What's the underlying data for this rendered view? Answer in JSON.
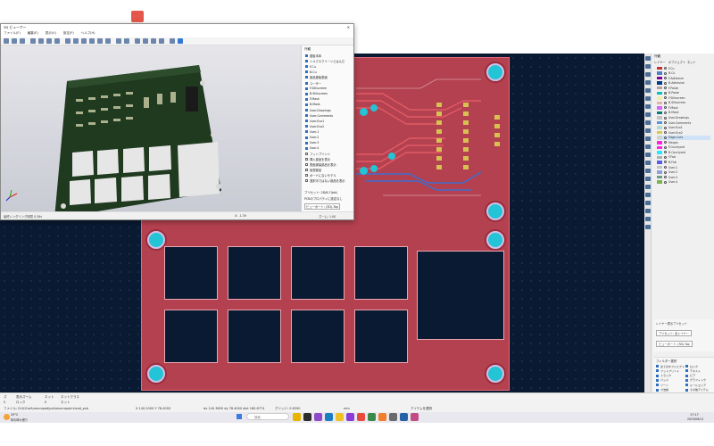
{
  "viewer": {
    "title": "3D ビューアー",
    "menu": [
      "ファイル(F)",
      "編集(E)",
      "表示(V)",
      "設定(P)",
      "ヘルプ(H)"
    ],
    "panel_title": "外観",
    "panel_items": [
      "基板本体",
      "シルクスクリーンとはんだ",
      "F.Cu",
      "B.Cu",
      "部品基板表面",
      "ユーザー",
      "F.Silkscreen",
      "B.Silkscreen",
      "F.Mask",
      "B.Mask",
      "User.Drawings",
      "User.Comments",
      "User.Eco1",
      "User.Eco2",
      "User.1",
      "User.2",
      "User.3",
      "User.4",
      "フットプリント",
      "挿入部品を表示",
      "表面実装部品を表示",
      "仮想部品",
      "ボードにないモデル",
      "選択中ではない部品を表示"
    ],
    "preset_label": "プリセット: 2D/6.7(blk)",
    "preset_value": "PCBのプロパティに設定なし",
    "viewport_label": "ビューポート: (3D)-Top",
    "status_left": "最終レンダリング時間 0.36s",
    "status_mid": "X: -1.39",
    "status_right": "ズーム: 1.00"
  },
  "layers": {
    "tabs": [
      "レイヤー",
      "オブジェクト",
      "ネット"
    ],
    "header": "外観",
    "items": [
      {
        "name": "F.Cu",
        "color": "#c83232"
      },
      {
        "name": "B.Cu",
        "color": "#4d7fc4"
      },
      {
        "name": "F.Adhesive",
        "color": "#84009a"
      },
      {
        "name": "B.Adhesive",
        "color": "#003a8c"
      },
      {
        "name": "F.Paste",
        "color": "#b4a0a0"
      },
      {
        "name": "B.Paste",
        "color": "#00c2c2"
      },
      {
        "name": "F.Silkscreen",
        "color": "#f2edaa"
      },
      {
        "name": "B.Silkscreen",
        "color": "#e8b2a7"
      },
      {
        "name": "F.Mask",
        "color": "#d864ff"
      },
      {
        "name": "B.Mask",
        "color": "#027b7b"
      },
      {
        "name": "User.Drawings",
        "color": "#c2c2c2"
      },
      {
        "name": "User.Comments",
        "color": "#5994dc"
      },
      {
        "name": "User.Eco1",
        "color": "#b4dbd2"
      },
      {
        "name": "User.Eco2",
        "color": "#d8c852"
      },
      {
        "name": "Edge.Cuts",
        "color": "#d0d2cd"
      },
      {
        "name": "Margin",
        "color": "#ff26e2"
      },
      {
        "name": "F.Courtyard",
        "color": "#ff26e2"
      },
      {
        "name": "B.Courtyard",
        "color": "#26e9ff"
      },
      {
        "name": "F.Fab",
        "color": "#afafaf"
      },
      {
        "name": "B.Fab",
        "color": "#585dec"
      },
      {
        "name": "User.1",
        "color": "#c2c2c2"
      },
      {
        "name": "User.2",
        "color": "#8da2d9"
      },
      {
        "name": "User.3",
        "color": "#6e9e8a"
      },
      {
        "name": "User.4",
        "color": "#7ab44f"
      }
    ],
    "highlight": "Edge.Cuts"
  },
  "render_panel": {
    "title": "レイヤー表示プリセット",
    "preset": "プリセット: 全レイヤー",
    "viewport": "ビューポート: (3D)-Top"
  },
  "filter_panel": {
    "title": "フィルター選択",
    "items": [
      "全てのオブジェクト",
      "ロック",
      "フットプリント",
      "テキスト",
      "トラック",
      "ビア",
      "パッド",
      "グラフィック",
      "ゾーン",
      "ルールエリア",
      "寸法線",
      "その他アイテム"
    ]
  },
  "status": {
    "row1": [
      "ズ",
      "表示ズーム",
      "ネット",
      "ネットクラス"
    ],
    "row2": [
      "0",
      "ロック",
      "0",
      "ネット"
    ],
    "file": "ファイル: D:\\KiCad\\macropad\\pcb\\macropad.kicad_pcb",
    "coords": "X 140.2000  Y 78.4000",
    "delta": "dx 140.3600  dy 78.4000  dist 160.6774",
    "grid": "グリッド: 0.6350",
    "unit": "mm",
    "mode": "アイテムを選択"
  },
  "taskbar": {
    "weather_temp": "29°C",
    "weather_text": "晴れ時々曇り",
    "search_placeholder": "検索",
    "time": "17:17",
    "date": "2023/06/11"
  },
  "colors": {
    "board": "#b4414f",
    "canvas": "#0a1a33",
    "hole": "#22c4d6"
  }
}
